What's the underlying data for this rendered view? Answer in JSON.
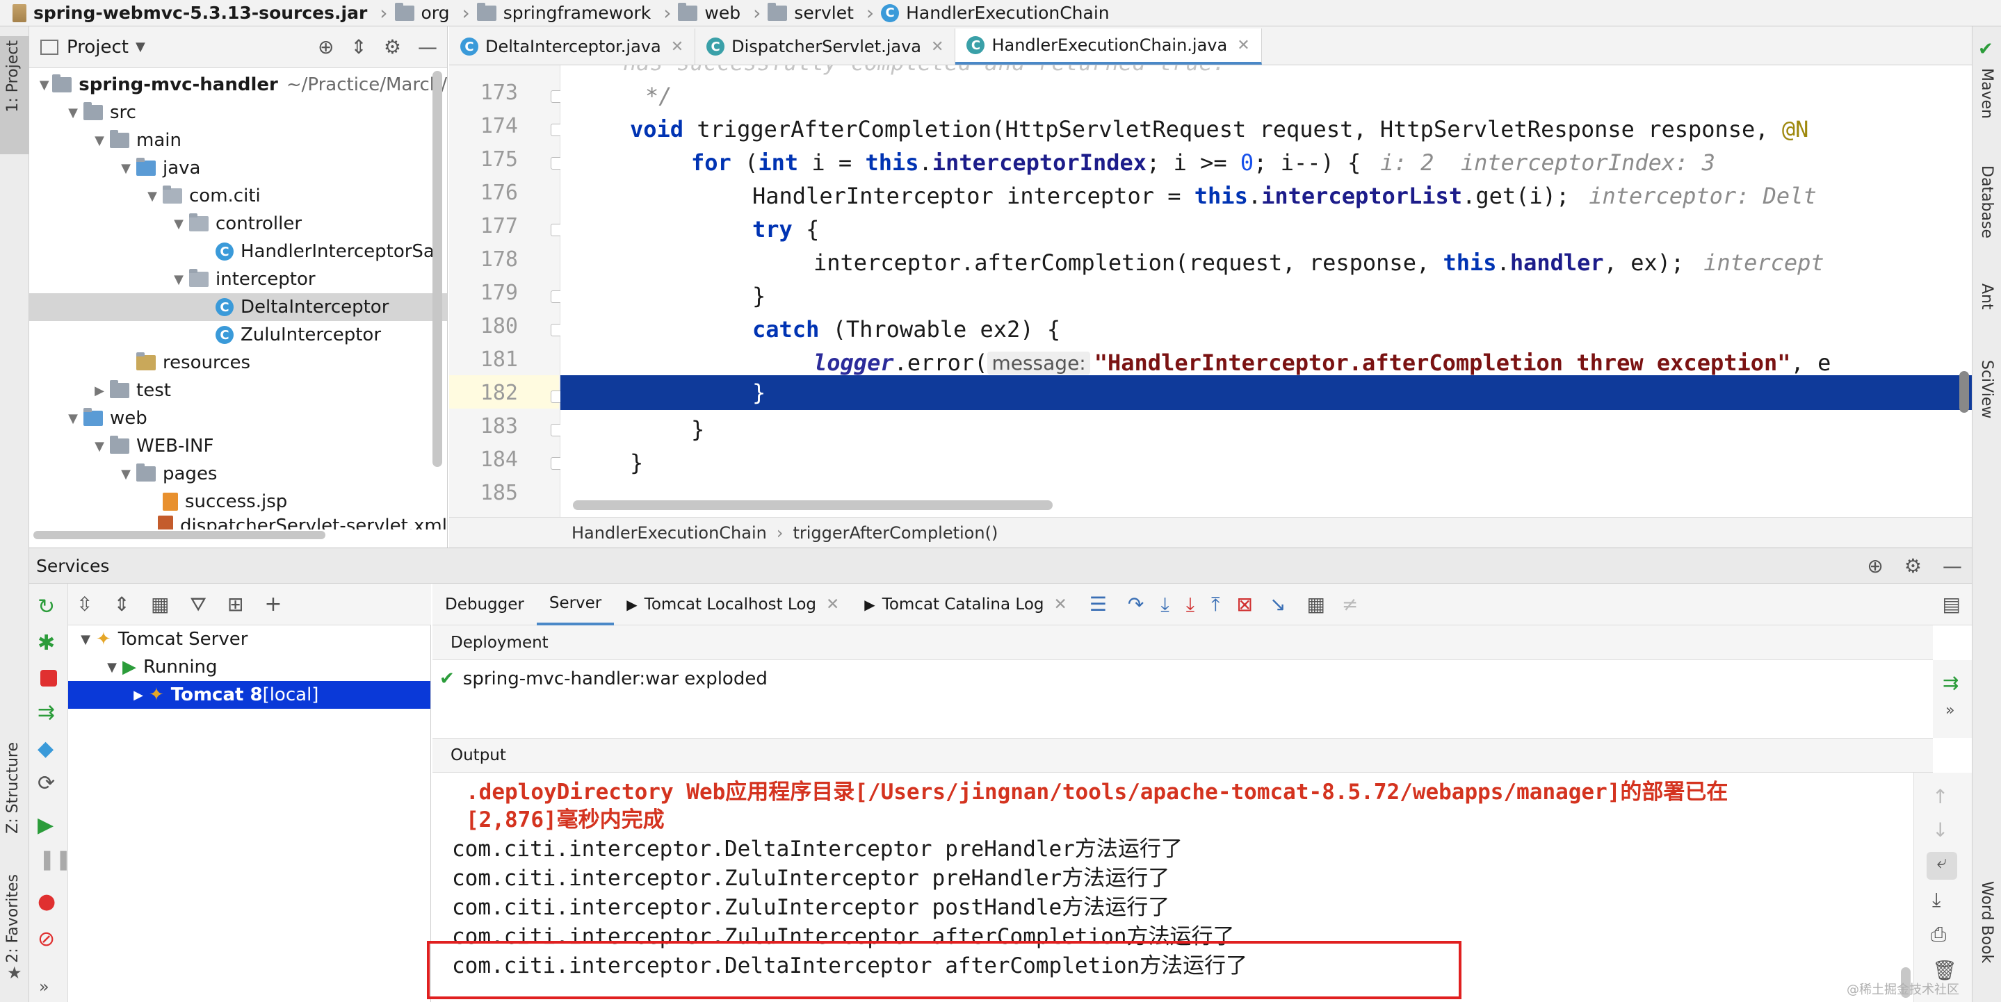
{
  "breadcrumb": [
    "spring-webmvc-5.3.13-sources.jar",
    "org",
    "springframework",
    "web",
    "servlet",
    "HandlerExecutionChain"
  ],
  "left_tabs": {
    "project": "1: Project",
    "structure": "Z: Structure",
    "favorites": "2: Favorites"
  },
  "right_tabs": {
    "maven": "Maven",
    "database": "Database",
    "ant": "Ant",
    "sciview": "SciView",
    "wordbook": "Word Book"
  },
  "project": {
    "title": "Project",
    "tree": [
      {
        "label": "spring-mvc-handler",
        "extra": "~/Practice/March/",
        "depth": 0,
        "arrow": "▼",
        "icon": "folder",
        "bold": true
      },
      {
        "label": "src",
        "depth": 1,
        "arrow": "▼",
        "icon": "folder"
      },
      {
        "label": "main",
        "depth": 2,
        "arrow": "▼",
        "icon": "folder"
      },
      {
        "label": "java",
        "depth": 3,
        "arrow": "▼",
        "icon": "folder-blue"
      },
      {
        "label": "com.citi",
        "depth": 4,
        "arrow": "▼",
        "icon": "package"
      },
      {
        "label": "controller",
        "depth": 5,
        "arrow": "▼",
        "icon": "package"
      },
      {
        "label": "HandlerInterceptorSar",
        "depth": 6,
        "arrow": "",
        "icon": "class"
      },
      {
        "label": "interceptor",
        "depth": 5,
        "arrow": "▼",
        "icon": "package"
      },
      {
        "label": "DeltaInterceptor",
        "depth": 6,
        "arrow": "",
        "icon": "class",
        "selected": true
      },
      {
        "label": "ZuluInterceptor",
        "depth": 6,
        "arrow": "",
        "icon": "class"
      },
      {
        "label": "resources",
        "depth": 3,
        "arrow": "",
        "icon": "folder-res"
      },
      {
        "label": "test",
        "depth": 2,
        "arrow": "▶",
        "icon": "folder"
      },
      {
        "label": "web",
        "depth": 1,
        "arrow": "▼",
        "icon": "folder-blue"
      },
      {
        "label": "WEB-INF",
        "depth": 2,
        "arrow": "▼",
        "icon": "folder"
      },
      {
        "label": "pages",
        "depth": 3,
        "arrow": "▼",
        "icon": "folder"
      },
      {
        "label": "success.jsp",
        "depth": 4,
        "arrow": "",
        "icon": "jsp"
      },
      {
        "label": "dispatcherServlet-servlet.xml",
        "depth": 4,
        "arrow": "",
        "icon": "xml"
      }
    ]
  },
  "editor": {
    "tabs": [
      {
        "label": "DeltaInterceptor.java",
        "active": false
      },
      {
        "label": "DispatcherServlet.java",
        "active": false
      },
      {
        "label": "HandlerExecutionChain.java",
        "active": true
      }
    ],
    "lines": [
      "173",
      "174",
      "175",
      "176",
      "177",
      "178",
      "179",
      "180",
      "181",
      "182",
      "183",
      "184",
      "185"
    ],
    "top_partial": "has successfully completed and returned true.",
    "code": {
      "l173": "*/",
      "l174_kw": "void",
      "l174": " triggerAfterCompletion(HttpServletRequest request, HttpServletResponse response, ",
      "l174_ann": "@N",
      "l175_for": "for",
      "l175_int": "int",
      "l175_this": "this",
      "l175_field": "interceptorIndex",
      "l175_rest": "; i >= ",
      "l175_zero": "0",
      "l175_end": "; i--) {",
      "l175_hint": "i: 2  interceptorIndex: 3",
      "l176_a": "HandlerInterceptor interceptor = ",
      "l176_this": "this",
      "l176_field": "interceptorList",
      "l176_b": ".get(i);",
      "l176_hint": "interceptor: Delt",
      "l177": "try",
      "l178_a": "interceptor.afterCompletion(request, response, ",
      "l178_this": "this",
      "l178_field": "handler",
      "l178_b": ", ex);",
      "l178_hint": "intercept",
      "l179": "}",
      "l180_kw": "catch",
      "l180": " (Throwable ex2) {",
      "l181_logger": "logger",
      "l181_a": ".error(",
      "l181_param": "message:",
      "l181_str": "\"HandlerInterceptor.afterCompletion threw exception\"",
      "l181_b": ", e",
      "l182": "}",
      "l183": "}",
      "l184": "}"
    },
    "crumb": {
      "cls": "HandlerExecutionChain",
      "method": "triggerAfterCompletion()"
    }
  },
  "services": {
    "title": "Services",
    "tree": [
      {
        "label": "Tomcat Server",
        "depth": 0,
        "arrow": "▼"
      },
      {
        "label": "Running",
        "depth": 1,
        "arrow": "▼"
      },
      {
        "label": "Tomcat 8",
        "suffix": " [local]",
        "depth": 2,
        "arrow": "▶",
        "selected": true
      }
    ],
    "tabs": [
      "Debugger",
      "Server",
      "Tomcat Localhost Log",
      "Tomcat Catalina Log"
    ],
    "deployment_label": "Deployment",
    "deployment_item": "spring-mvc-handler:war exploded",
    "output_label": "Output",
    "output": {
      "err1": ".deployDirectory Web应用程序目录[/Users/jingnan/tools/apache-tomcat-8.5.72/webapps/manager]的部署已在",
      "err2": "[2,876]毫秒内完成",
      "l1": "com.citi.interceptor.DeltaInterceptor preHandler方法运行了",
      "l2": "com.citi.interceptor.ZuluInterceptor preHandler方法运行了",
      "l3": "com.citi.interceptor.ZuluInterceptor postHandle方法运行了",
      "l4": "com.citi.interceptor.ZuluInterceptor afterCompletion方法运行了",
      "l5": "com.citi.interceptor.DeltaInterceptor afterCompletion方法运行了"
    }
  },
  "watermark": "@稀土掘金技术社区",
  "colors": {
    "accent": "#4a88c7",
    "selection": "#0f3a9a",
    "highlight_box": "#e02020",
    "error_text": "#d4331f"
  }
}
